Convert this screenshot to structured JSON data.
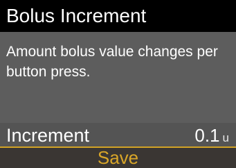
{
  "header": {
    "title": "Bolus Increment"
  },
  "content": {
    "description": "Amount bolus value changes per button press."
  },
  "setting": {
    "label": "Increment",
    "value": "0.1",
    "unit": "u"
  },
  "actions": {
    "save_label": "Save"
  },
  "colors": {
    "accent": "#d9a628",
    "panel": "#5d5d5d",
    "title_bar": "#000000"
  }
}
